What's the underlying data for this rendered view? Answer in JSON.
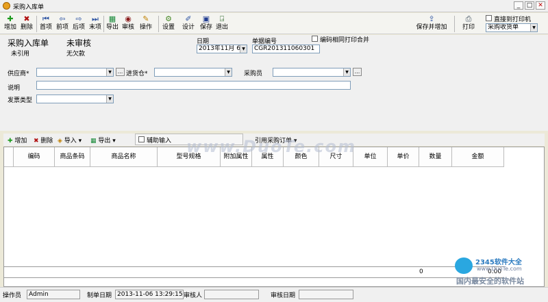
{
  "window": {
    "title": "采购入库单",
    "min": "_",
    "max": "□",
    "close": "✕"
  },
  "toolbar": {
    "add": "增加",
    "delete": "删除",
    "first": "首项",
    "prev": "前项",
    "next": "后项",
    "last": "末项",
    "export": "导出",
    "audit": "审核",
    "operate": "操作",
    "settings": "设置",
    "design": "设计",
    "save": "保存",
    "exit": "退出",
    "save_add": "保存并增加",
    "print": "打印",
    "direct_print": "直接到打印机",
    "print_template": "采购收货单"
  },
  "header": {
    "doc_title": "采购入库单",
    "audit_status": "未审核",
    "ref_status": "未引用",
    "debt_status": "无欠款",
    "date_label": "日期",
    "date_value": "2013年11月 6日",
    "docno_label": "单据编号",
    "docno_value": "CGR201311060301",
    "merge_label": "编码相同打印合并",
    "supplier_label": "供应商*",
    "supplier_value": "",
    "warehouse_label": "进货仓*",
    "warehouse_value": "",
    "buyer_label": "采购员",
    "buyer_value": "",
    "remark_label": "说明",
    "remark_value": "",
    "invoice_label": "发票类型",
    "invoice_value": ""
  },
  "grid_toolbar": {
    "add": "增加",
    "delete": "删除",
    "import": "导入",
    "export": "导出",
    "assist": "辅助输入",
    "ref_order": "引用采购订单"
  },
  "grid": {
    "columns": [
      "编码",
      "商品条码",
      "商品名称",
      "型号规格",
      "附加属性",
      "属性",
      "颜色",
      "尺寸",
      "单位",
      "单价",
      "数量",
      "金额"
    ],
    "footer_qty": "0",
    "footer_amount": "0.00"
  },
  "status": {
    "operator_label": "操作员",
    "operator_value": "Admin",
    "make_date_label": "制单日期",
    "make_date_value": "2013-11-06 13:29:15",
    "auditor_label": "审核人",
    "auditor_value": "",
    "audit_date_label": "审核日期",
    "audit_date_value": ""
  },
  "watermark": {
    "text": "www.DuoTe.com",
    "logo_text": "2345软件大全",
    "logo_url": "www.DuoTe.com",
    "slogan": "国内最安全的软件站"
  }
}
